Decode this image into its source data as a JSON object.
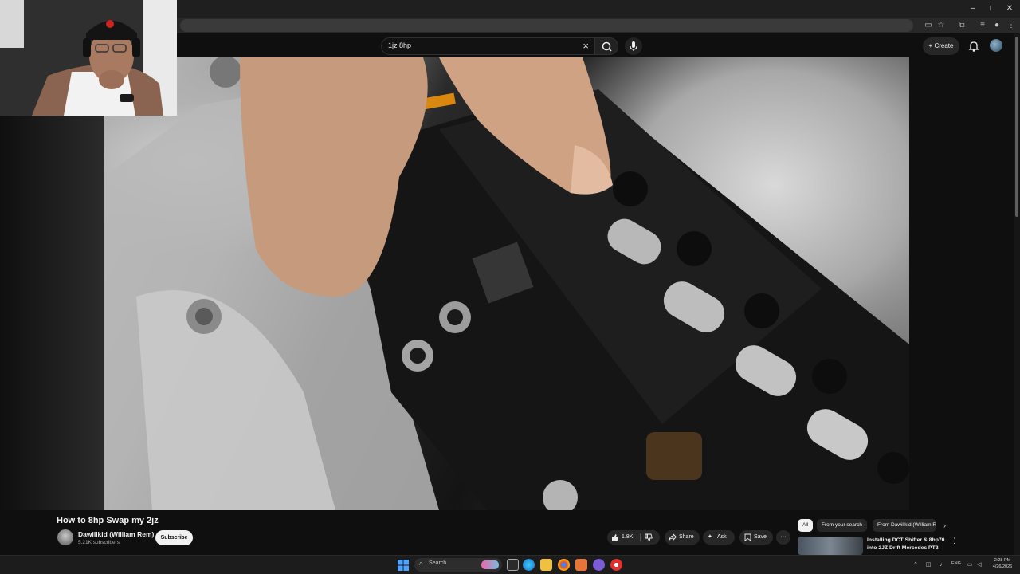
{
  "browser": {
    "window_controls": [
      "–",
      "□",
      "✕"
    ]
  },
  "search": {
    "query": "1jz 8hp"
  },
  "header": {
    "create_label": "Create"
  },
  "video": {
    "title": "How to 8hp Swap my 2jz",
    "channel": "Dawillkid (William Rem)",
    "subscribers": "5.21K subscribers",
    "subscribe_label": "Subscribe",
    "likes": "1.8K",
    "share_label": "Share",
    "ask_label": "Ask",
    "save_label": "Save",
    "more_label": "···"
  },
  "chips": [
    "All",
    "From your search",
    "From Dawillkid (William Rem)"
  ],
  "recommendation": {
    "title": "Installing DCT Shifter & 8hp70 into 2JZ Drift Mercedes PT2"
  },
  "taskbar": {
    "search_label": "Search",
    "language": "ENG",
    "time": "2:28 PM",
    "date": "4/26/2026"
  },
  "colors": {
    "background": "#0f0f0f",
    "pill": "#272727",
    "text": "#f1f1f1"
  }
}
